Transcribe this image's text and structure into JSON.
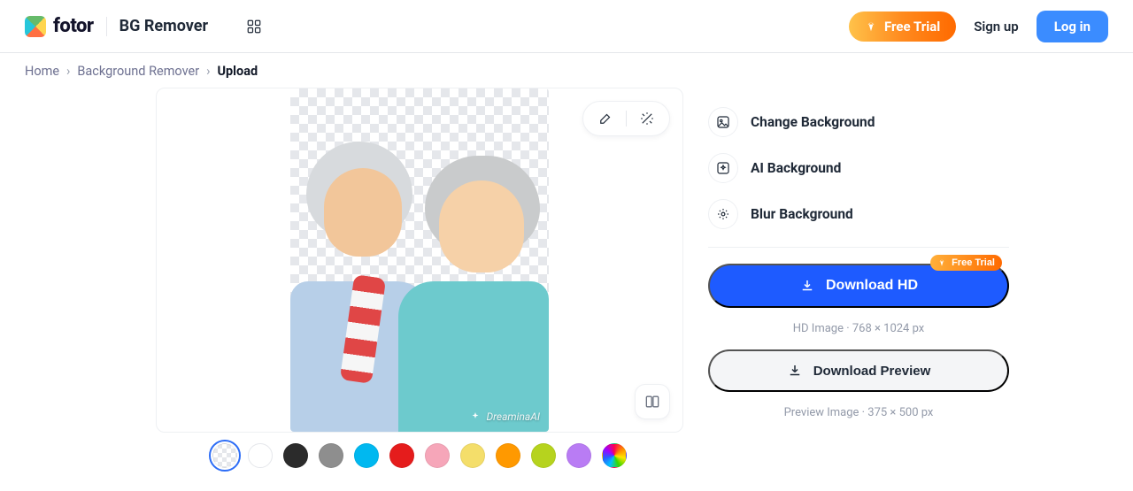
{
  "header": {
    "brand": "fotor",
    "product": "BG Remover",
    "free_trial": "Free Trial",
    "signup": "Sign up",
    "login": "Log in"
  },
  "breadcrumb": {
    "items": [
      "Home",
      "Background Remover",
      "Upload"
    ]
  },
  "canvas": {
    "watermark": "DreaminaAI"
  },
  "swatches": {
    "selected_index": 0,
    "items": [
      {
        "id": "transparent",
        "label": "Transparent"
      },
      {
        "id": "white",
        "label": "White",
        "hex": "#FFFFFF"
      },
      {
        "id": "black",
        "label": "Black",
        "hex": "#2B2B2B"
      },
      {
        "id": "gray",
        "label": "Gray",
        "hex": "#8E8E8E"
      },
      {
        "id": "cyan",
        "label": "Cyan",
        "hex": "#00B8F0"
      },
      {
        "id": "red",
        "label": "Red",
        "hex": "#E51C1C"
      },
      {
        "id": "pink",
        "label": "Pink",
        "hex": "#F6A6B9"
      },
      {
        "id": "yellow",
        "label": "Yellow",
        "hex": "#F4DE6A"
      },
      {
        "id": "orange",
        "label": "Orange",
        "hex": "#FF9900"
      },
      {
        "id": "lime",
        "label": "Lime",
        "hex": "#B6D31E"
      },
      {
        "id": "purple",
        "label": "Purple",
        "hex": "#B97CF4"
      },
      {
        "id": "rainbow",
        "label": "Custom"
      }
    ]
  },
  "panel": {
    "actions": {
      "change_bg": "Change Background",
      "ai_bg": "AI Background",
      "blur_bg": "Blur Background"
    },
    "download_hd_label": "Download HD",
    "download_hd_badge": "Free Trial",
    "hd_note": "HD Image · 768 × 1024 px",
    "download_preview_label": "Download Preview",
    "preview_note": "Preview Image · 375 × 500 px"
  }
}
